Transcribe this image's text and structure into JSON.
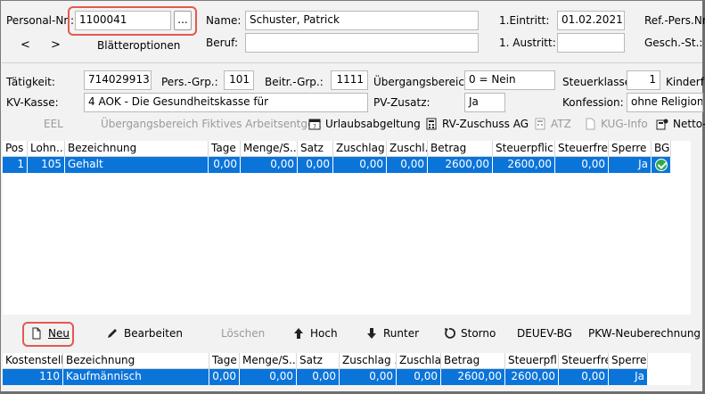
{
  "header": {
    "personal_nr_label": "Personal-Nr.:",
    "personal_nr_value": "1100041",
    "dots": "...",
    "prev": "<",
    "next": ">",
    "blaetter": "Blätteroptionen",
    "name_label": "Name:",
    "name_value": "Schuster, Patrick",
    "beruf_label": "Beruf:",
    "beruf_value": "",
    "eintritt_label": "1.Eintritt:",
    "eintritt_value": "01.02.2021",
    "austritt_label": "1. Austritt:",
    "austritt_value": "",
    "refpers_label": "Ref.-Pers.Nr.",
    "geschst_label": "Gesch.-St.:"
  },
  "details": {
    "taetigkeit_label": "Tätigkeit:",
    "taetigkeit_value": "714029913",
    "persgrp_label": "Pers.-Grp.:",
    "persgrp_value": "101",
    "beitrgrp_label": "Beitr.-Grp.:",
    "beitrgrp_value": "1111",
    "uebergang_label": "Übergangsbereich:",
    "uebergang_value": "0 = Nein",
    "steuerklasse_label": "Steuerklasse:",
    "steuerklasse_value": "1",
    "kinderfrei_label": "Kinderfrei",
    "kvkasse_label": "KV-Kasse:",
    "kvkasse_value": "4 AOK - Die Gesundheitskasse für",
    "pvzusatz_label": "PV-Zusatz:",
    "pvzusatz_value": "Ja",
    "konfession_label": "Konfession:",
    "konfession_value": "ohne Religionszu"
  },
  "toolbar": {
    "eel": "EEL",
    "uebergang_fiktiv": "Übergangsbereich Fiktives Arbeitsentgelt",
    "urlaubsabgeltung": "Urlaubsabgeltung",
    "rv_zuschuss": "RV-Zuschuss AG",
    "atz": "ATZ",
    "kug_info": "KUG-Info",
    "netto": "Netto-"
  },
  "main_grid": {
    "columns": [
      "Pos",
      "Lohn...",
      "Bezeichnung",
      "Tage",
      "Menge/S...",
      "Satz",
      "Zuschlag ...",
      "Zuschl...",
      "Betrag",
      "Steuerpflic...",
      "Steuerfrei",
      "Sperre",
      "BG"
    ],
    "rows": [
      [
        "1",
        "105",
        "Gehalt",
        "0,00",
        "0,00",
        "0,00",
        "0,00",
        "0,00",
        "2600,00",
        "2600,00",
        "0,00",
        "Ja",
        ""
      ]
    ]
  },
  "actions": {
    "neu": "Neu",
    "bearbeiten": "Bearbeiten",
    "loeschen": "Löschen",
    "hoch": "Hoch",
    "runter": "Runter",
    "storno": "Storno",
    "deuev": "DEUEV-BG",
    "pkw": "PKW-Neuberechnung"
  },
  "cost_grid": {
    "columns": [
      "Kostenstelle",
      "Bezeichnung",
      "Tage",
      "Menge/S...",
      "Satz",
      "Zuschlag ...",
      "Zuschlag",
      "Betrag",
      "Steuerpfl...",
      "Steuerfrei",
      "Sperre"
    ],
    "rows": [
      [
        "110",
        "Kaufmännisch",
        "0,00",
        "0,00",
        "0,00",
        "0,00",
        "0,00",
        "2600,00",
        "2600,00",
        "0,00",
        "Ja"
      ]
    ]
  },
  "colors": {
    "selection": "#0b74d9",
    "highlight": "#e05a50",
    "check": "#2fa84f"
  }
}
